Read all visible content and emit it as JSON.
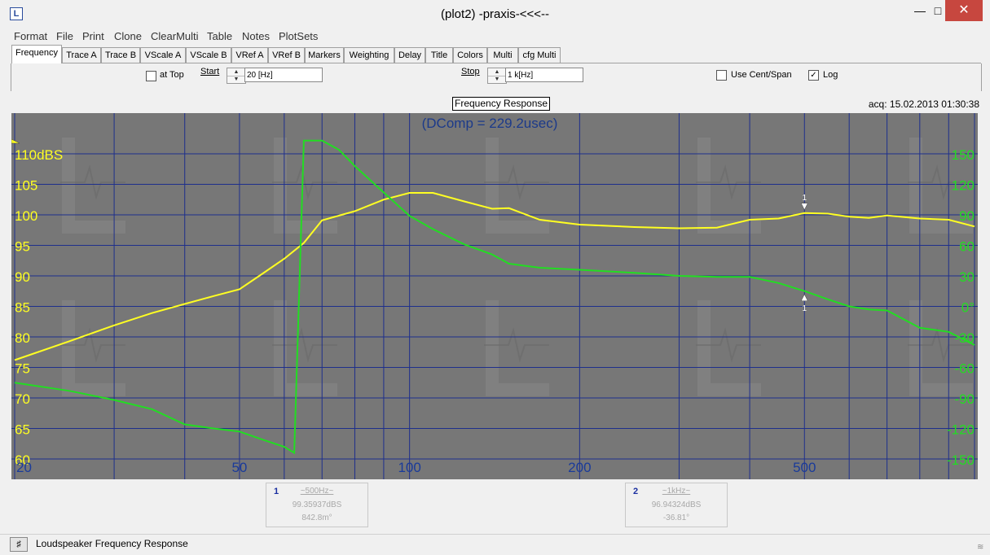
{
  "window": {
    "title": "(plot2) -praxis-<<<--",
    "app_icon": "L",
    "controls": {
      "minimize": "—",
      "maximize": "□",
      "close": "✕"
    }
  },
  "menu": [
    "Format",
    "File",
    "Print",
    "Clone",
    "ClearMulti",
    "Table",
    "Notes",
    "PlotSets"
  ],
  "tabs": [
    {
      "label": "Frequency",
      "active": true
    },
    {
      "label": "Trace A"
    },
    {
      "label": "Trace B"
    },
    {
      "label": "VScale A"
    },
    {
      "label": "VScale B"
    },
    {
      "label": "VRef A"
    },
    {
      "label": "VRef B"
    },
    {
      "label": "Markers"
    },
    {
      "label": "Weighting"
    },
    {
      "label": "Delay"
    },
    {
      "label": "Title"
    },
    {
      "label": "Colors"
    },
    {
      "label": "Multi"
    },
    {
      "label": "cfg Multi"
    }
  ],
  "controls": {
    "at_top": {
      "label": "at Top",
      "checked": false
    },
    "start": {
      "label": "Start",
      "value": "20 [Hz]"
    },
    "stop": {
      "label": "Stop",
      "value": "1 k[Hz]"
    },
    "use_cent_span": {
      "label": "Use Cent/Span",
      "checked": false
    },
    "log": {
      "label": "Log",
      "checked": true
    }
  },
  "plot": {
    "title": "Frequency Response",
    "acq": "acq: 15.02.2013 01:30:38",
    "annotation": "(DComp = 229.2usec)"
  },
  "readouts": [
    {
      "index": "1",
      "freq": "~500Hz~",
      "level": "99.35937dBS",
      "phase": "842.8m°"
    },
    {
      "index": "2",
      "freq": "~1kHz~",
      "level": "96.94324dBS",
      "phase": "-36.81°"
    }
  ],
  "status": {
    "text": "Loudspeaker Frequency Response",
    "icon": "speaker-icon"
  },
  "colors": {
    "plot_bg": "#777777",
    "grid": "#1e2f8c",
    "trace_a": "#ffff22",
    "trace_b": "#22dd22",
    "annotation": "#1c3a8a",
    "window_close": "#c7473f"
  },
  "chart_data": {
    "type": "line",
    "title": "Frequency Response",
    "xscale": "log",
    "xlim": [
      20,
      1000
    ],
    "x_tick_labels": [
      "20",
      "50",
      "100",
      "200",
      "500"
    ],
    "y_left": {
      "range": [
        60,
        110
      ],
      "unit": "dBS",
      "tick_labels": [
        "110dBS",
        "105",
        "100",
        "95",
        "90",
        "85",
        "80",
        "75",
        "70",
        "65",
        "60"
      ]
    },
    "y_right": {
      "range": [
        -150,
        150
      ],
      "unit": "°",
      "tick_labels": [
        "150",
        "120",
        "90",
        "60",
        "30",
        "0°",
        "-30",
        "-60",
        "-90",
        "-120",
        "-150"
      ]
    },
    "series": [
      {
        "trace": "A",
        "color": "#ffff22",
        "axis": "left",
        "x": [
          20,
          25,
          30,
          35,
          40,
          45,
          50,
          55,
          60,
          65,
          70,
          80,
          90,
          100,
          110,
          125,
          140,
          150,
          170,
          200,
          250,
          300,
          350,
          400,
          450,
          500,
          550,
          600,
          650,
          700,
          800,
          900,
          1000
        ],
        "y": [
          76.2,
          79.3,
          81.9,
          83.9,
          85.4,
          86.7,
          87.8,
          90.4,
          92.8,
          95.4,
          99.1,
          100.6,
          102.5,
          103.6,
          103.6,
          102.2,
          101.0,
          101.1,
          99.2,
          98.4,
          98.0,
          97.8,
          97.9,
          99.2,
          99.4,
          100.3,
          100.2,
          99.7,
          99.5,
          99.9,
          99.4,
          99.2,
          98.1
        ]
      },
      {
        "trace": "B",
        "color": "#22dd22",
        "axis": "right",
        "x": [
          20,
          25,
          30,
          35,
          40,
          45,
          50,
          55,
          60,
          62.5,
          65,
          70,
          75,
          80,
          90,
          100,
          110,
          125,
          140,
          150,
          170,
          200,
          250,
          300,
          350,
          400,
          450,
          500,
          550,
          600,
          650,
          700,
          800,
          900,
          1000
        ],
        "y": [
          -75,
          -83,
          -92,
          -101,
          -116,
          -120,
          -123,
          -131,
          -138,
          -144,
          163,
          163,
          154,
          138,
          112,
          89,
          76,
          61,
          51,
          42,
          38,
          36,
          33,
          30,
          29,
          29,
          23,
          15,
          7,
          0,
          -3,
          -4,
          -21,
          -25,
          -38
        ]
      }
    ],
    "markers": [
      {
        "label": "1",
        "trace": "A",
        "x": 500
      },
      {
        "label": "1",
        "trace": "B",
        "x": 500
      }
    ]
  }
}
